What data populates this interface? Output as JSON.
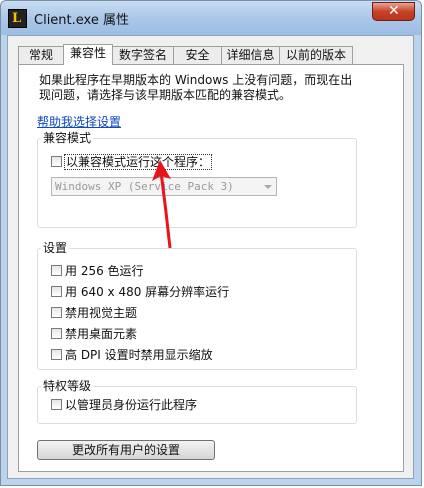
{
  "window": {
    "title": "Client.exe 属性",
    "close_glyph": "✕",
    "app_icon_letter": "L"
  },
  "tabs": [
    "常规",
    "兼容性",
    "数字签名",
    "安全",
    "详细信息",
    "以前的版本"
  ],
  "active_tab": "兼容性",
  "intro": {
    "line1": "如果此程序在早期版本的 Windows 上没有问题，而现在出",
    "line2": "现问题，请选择与该早期版本匹配的兼容模式。"
  },
  "help_link": "帮助我选择设置",
  "compat_group": {
    "legend": "兼容模式",
    "checkbox_label": "以兼容模式运行这个程序：",
    "checked": false,
    "os_select_value": "Windows XP (Service Pack 3)"
  },
  "settings_group": {
    "legend": "设置",
    "options": [
      {
        "label": "用 256 色运行",
        "checked": false
      },
      {
        "label": "用 640 x 480 屏幕分辨率运行",
        "checked": false
      },
      {
        "label": "禁用视觉主题",
        "checked": false
      },
      {
        "label": "禁用桌面元素",
        "checked": false
      },
      {
        "label": "高 DPI 设置时禁用显示缩放",
        "checked": false
      }
    ]
  },
  "privilege_group": {
    "legend": "特权等级",
    "checkbox_label": "以管理员身份运行此程序",
    "checked": false
  },
  "all_users_button": "更改所有用户的设置",
  "annotation": {
    "color": "#e8141c",
    "icon": "arrow-up-icon"
  },
  "colors": {
    "frame": "#bcd3ec",
    "link": "#0d47c1",
    "close_button": "#c6432a"
  }
}
